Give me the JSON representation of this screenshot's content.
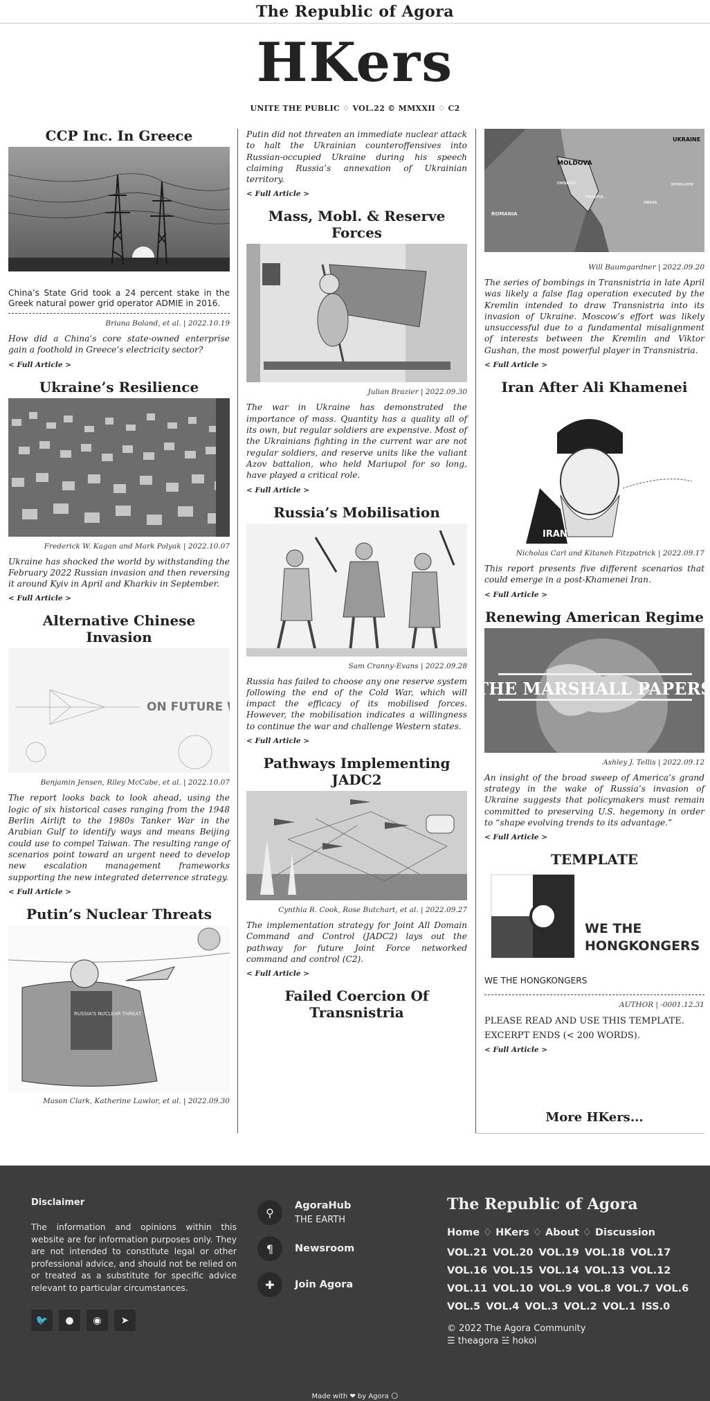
{
  "topbar": {
    "brand": "The Republic of Agora"
  },
  "masthead": {
    "logo": "HKers",
    "tagline": "UNITE THE PUBLIC ♢ VOL.22 © MMXXII ♢ C2"
  },
  "column1": [
    {
      "title": "CCP Inc. In Greece",
      "summary": "China’s State Grid took a 24 percent stake in the Greek natural power grid operator ADMIE in 2016.",
      "byline": "Briana Boland, et al. | 2022.10.19",
      "excerpt": "How did a China’s core state-owned enterprise gain a foothold in Greece’s electricity sector?",
      "more": "< Full Article >"
    },
    {
      "title": "Ukraine’s Resilience",
      "byline": "Frederick W. Kagan and Mark Polyak | 2022.10.07",
      "excerpt": "Ukraine has shocked the world by withstanding the February 2022 Russian invasion and then reversing it around Kyiv in April and Kharkiv in September.",
      "more": "< Full Article >"
    },
    {
      "title": "Alternative Chinese Invasion",
      "image_text": "ON FUTURE WAR",
      "byline": "Benjamin Jensen, Riley McCabe, et al. | 2022.10.07",
      "excerpt": "The report looks back to look ahead, using the logic of six historical cases ranging from the 1948 Berlin Airlift to the 1980s Tanker War in the Arabian Gulf to identify ways and means Beijing could use to compel Taiwan. The resulting range of scenarios point toward an urgent need to develop new escalation management frameworks supporting the new integrated deterrence strategy.",
      "more": "< Full Article >"
    },
    {
      "title": "Putin’s Nuclear Threats",
      "image_text": "RUSSIA'S NUCLEAR THREAT",
      "byline": "Mason Clark, Katherine Lawlor, et al. | 2022.09.30"
    }
  ],
  "column2": [
    {
      "excerpt": "Putin did not threaten an immediate nuclear attack to halt the Ukrainian counteroffensives into Russian-occupied Ukraine during his speech claiming Russia’s annexation of Ukrainian territory.",
      "more": "< Full Article >"
    },
    {
      "title": "Mass, Mobl. & Reserve Forces",
      "byline": "Julian Brazier | 2022.09.30",
      "excerpt": "The war in Ukraine has demonstrated the importance of mass. Quantity has a quality all of its own, but regular soldiers are expensive. Most of the Ukrainians fighting in the current war are not regular soldiers, and reserve units like the valiant Azov battalion, who held Mariupol for so long, have played a critical role.",
      "more": "< Full Article >"
    },
    {
      "title": "Russia’s Mobilisation",
      "byline": "Sam Cranny-Evans | 2022.09.28",
      "excerpt": "Russia has failed to choose any one reserve system following the end of the Cold War, which will impact the efficacy of its mobilised forces. However, the mobilisation indicates a willingness to continue the war and challenge Western states.",
      "more": "< Full Article >"
    },
    {
      "title": "Pathways Implementing JADC2",
      "byline": "Cynthia R. Cook, Rose Butchart, et al. | 2022.09.27",
      "excerpt": "The implementation strategy for Joint All Domain Command and Control (JADC2) lays out the pathway for future Joint Force networked command and control (C2).",
      "more": "< Full Article >"
    },
    {
      "title": "Failed Coercion Of Transnistria"
    }
  ],
  "column3": [
    {
      "map_labels": [
        "UKRAINE",
        "MOLDOVA",
        "ROMANIA",
        "CHIȘINĂU",
        "TIRASPOL",
        "ODESA",
        "MYKOLAYIV"
      ],
      "byline": "Will Baumgardner | 2022.09.20",
      "excerpt": "The series of bombings in Transnistria in late April was likely a false flag operation executed by the Kremlin intended to draw Transnistria into its invasion of Ukraine. Moscow’s effort was likely unsuccessful due to a fundamental misalignment of interests between the Kremlin and Viktor Gushan, the most powerful player in Transnistria.",
      "more": "< Full Article >"
    },
    {
      "title": "Iran After Ali Khamenei",
      "image_text": "IRAN",
      "byline": "Nicholas Carl and Kitaneh Fitzpatrick | 2022.09.17",
      "excerpt": "This report presents five different scenarios that could emerge in a post-Khamenei Iran.",
      "more": "< Full Article >"
    },
    {
      "title": "Renewing American Regime",
      "image_text": "THE MARSHALL PAPERS",
      "byline": "Ashley J. Tellis | 2022.09.12",
      "excerpt": "An insight of the broad sweep of America’s grand strategy in the wake of Russia’s invasion of Ukraine suggests that policymakers must remain committed to preserving U.S. hegemony in order to “shape evolving trends to its advantage.”",
      "more": "< Full Article >"
    },
    {
      "title": "TEMPLATE",
      "logo_text": [
        "WE THE",
        "HONGKONGERS"
      ],
      "summary": "WE THE HONGKONGERS",
      "byline": "AUTHOR | -0001.12.31",
      "excerpt1": "PLEASE READ AND USE THIS TEMPLATE.",
      "excerpt2": "EXCERPT ENDS (< 200 WORDS).",
      "more": "< Full Article >"
    }
  ],
  "more_link": "More HKers...",
  "footer": {
    "disclaimer_title": "Disclaimer",
    "disclaimer": "The information and opinions within this website are for information purposes only. They are not intended to constitute legal or other professional advice, and should not be relied on or treated as a substitute for specific advice relevant to particular circumstances.",
    "social_icons": [
      "twitter-icon",
      "github-icon",
      "reddit-icon",
      "telegram-icon"
    ],
    "hub_title": "AgoraHub",
    "hub_sub": "THE EARTH",
    "newsroom": "Newsroom",
    "join": "Join Agora",
    "brand": "The Republic of Agora",
    "nav": [
      "Home",
      "HKers",
      "About",
      "Discussion"
    ],
    "vols": [
      "VOL.21",
      "VOL.20",
      "VOL.19",
      "VOL.18",
      "VOL.17",
      "VOL.16",
      "VOL.15",
      "VOL.14",
      "VOL.13",
      "VOL.12",
      "VOL.11",
      "VOL.10",
      "VOL.9",
      "VOL.8",
      "VOL.7",
      "VOL.6",
      "VOL.5",
      "VOL.4",
      "VOL.3",
      "VOL.2",
      "VOL.1",
      "ISS.0"
    ],
    "copyright": "© 2022 The Agora Community",
    "links": "☰ theagora ☱ hokoi",
    "made_with": "Made with ❤ by Agora 🌕"
  }
}
